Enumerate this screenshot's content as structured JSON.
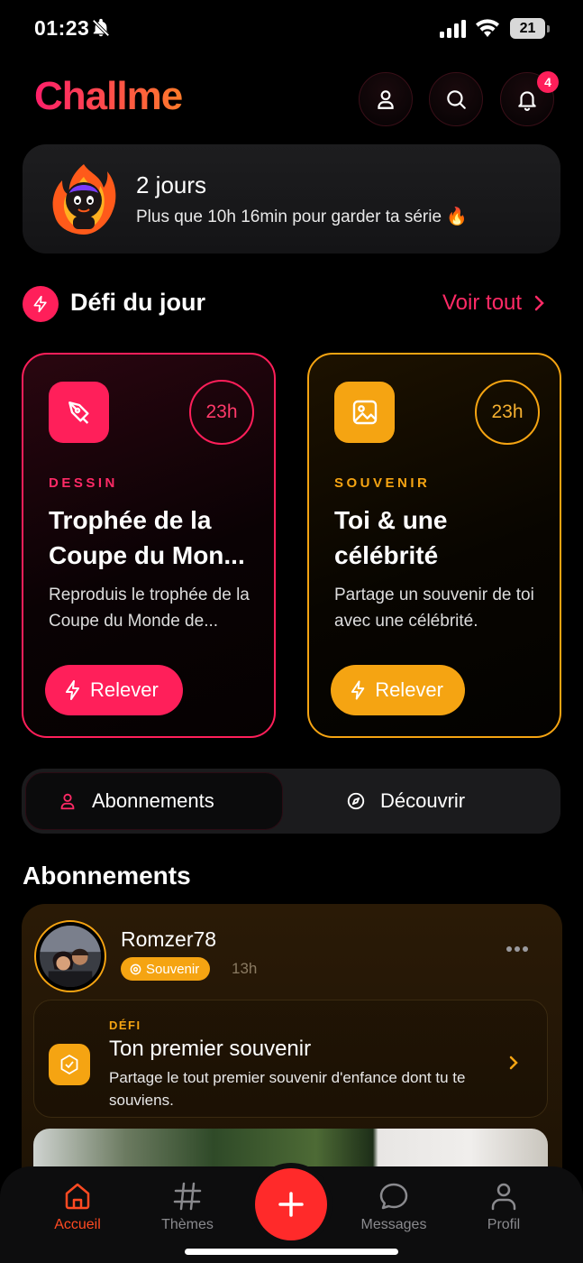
{
  "status_bar": {
    "time": "01:23",
    "battery": "21"
  },
  "header": {
    "app_name": "Challme",
    "notification_count": "4"
  },
  "streak": {
    "days": "2 jours",
    "message": "Plus que 10h 16min pour garder ta série 🔥"
  },
  "daily_challenge": {
    "title": "Défi du jour",
    "see_all": "Voir tout",
    "cards": [
      {
        "category": "DESSIN",
        "timer": "23h",
        "title": "Trophée de la Coupe du Mon...",
        "description": "Reproduis le trophée de la Coupe du Monde de...",
        "button": "Relever",
        "accent": "#ff1f5a"
      },
      {
        "category": "SOUVENIR",
        "timer": "23h",
        "title": "Toi & une célébrité",
        "description": "Partage un souvenir de toi avec une célébrité.",
        "button": "Relever",
        "accent": "#f5a412"
      }
    ]
  },
  "tabs": {
    "subscriptions": "Abonnements",
    "discover": "Découvrir",
    "active": "subscriptions"
  },
  "feed": {
    "title": "Abonnements",
    "post": {
      "username": "Romzer78",
      "tag": "Souvenir",
      "time": "13h",
      "challenge_label": "DÉFI",
      "challenge_title": "Ton premier souvenir",
      "challenge_description": "Partage le tout premier souvenir d'enfance dont tu te souviens."
    }
  },
  "bottom_nav": {
    "items": [
      {
        "label": "Accueil",
        "icon": "home-icon",
        "active": true
      },
      {
        "label": "Thèmes",
        "icon": "hashtag-icon",
        "active": false
      },
      {
        "label": "Messages",
        "icon": "chat-bubble-icon",
        "active": false
      },
      {
        "label": "Profil",
        "icon": "person-icon",
        "active": false
      }
    ],
    "fab_icon": "plus-icon"
  },
  "colors": {
    "pink": "#ff1f5a",
    "orange": "#f5a412",
    "nav_active": "#ff4a22",
    "fab": "#ff2a2a"
  }
}
